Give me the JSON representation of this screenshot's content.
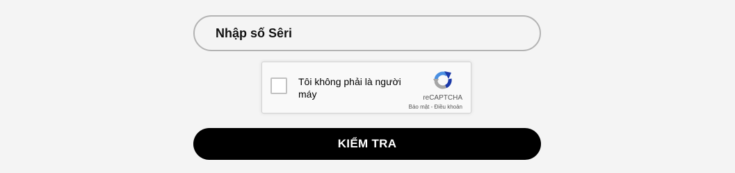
{
  "form": {
    "serial_placeholder": "Nhập số Sêri",
    "serial_value": "",
    "submit_label": "KIỂM TRA"
  },
  "recaptcha": {
    "label": "Tôi không phải là người máy",
    "brand": "reCAPTCHA",
    "privacy_label": "Bảo mật",
    "separator": " - ",
    "terms_label": "Điều khoản",
    "logo_icon": "recaptcha-logo-icon",
    "colors": {
      "blue": "#1c3aa9",
      "light_blue": "#4a90e2",
      "gray": "#b3b3b3"
    }
  },
  "colors": {
    "background": "#f4f4f4",
    "button": "#000000",
    "button_text": "#ffffff",
    "input_border": "#b3b3b3"
  }
}
